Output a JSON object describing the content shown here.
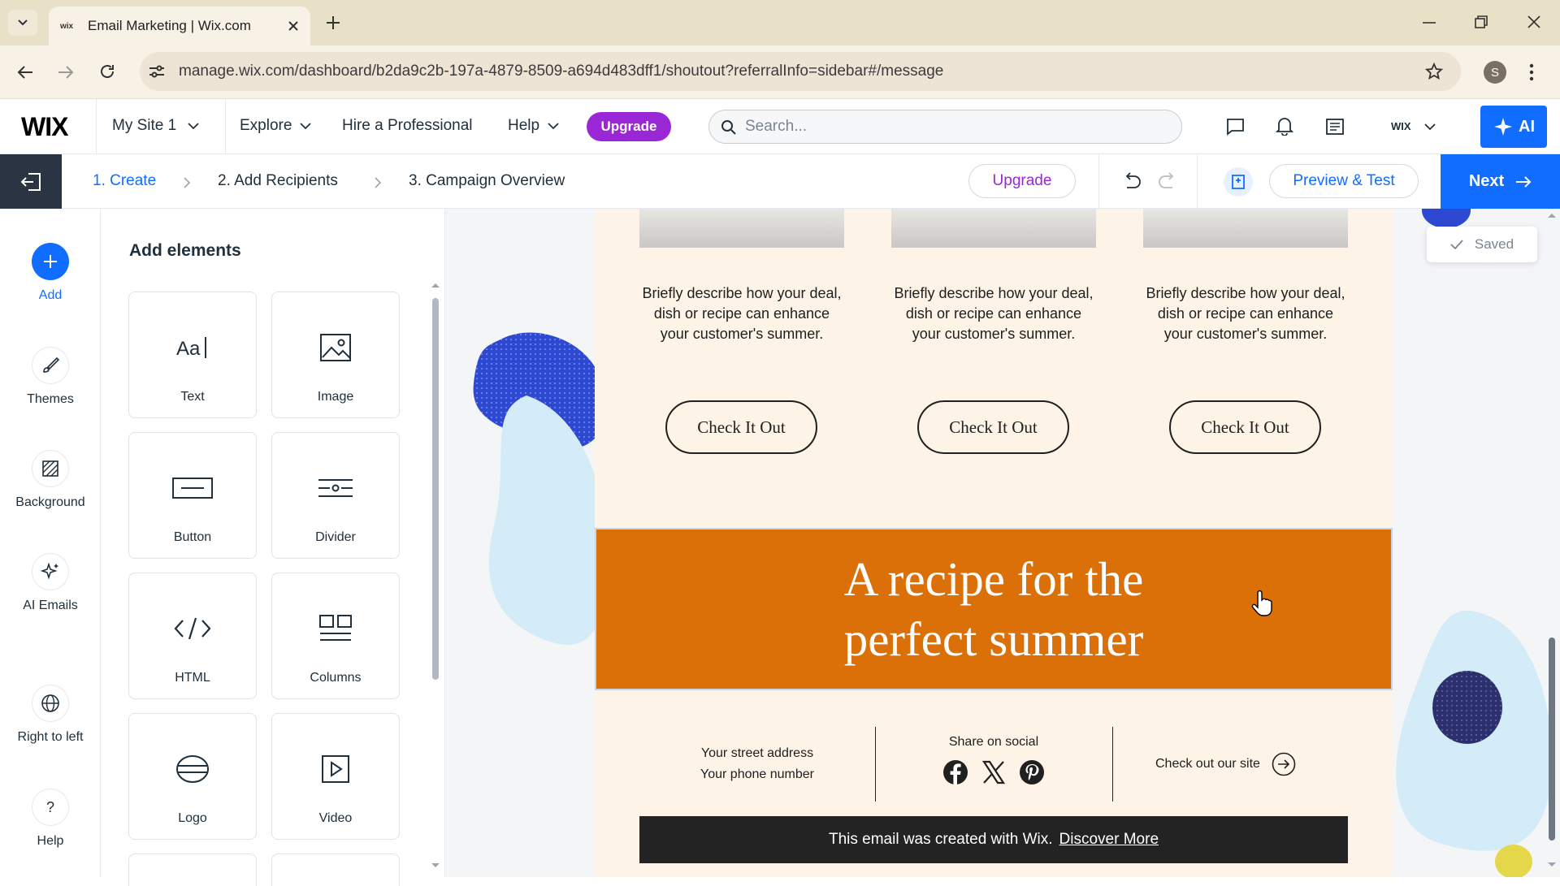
{
  "browser": {
    "tab_title": "Email Marketing | Wix.com",
    "url": "manage.wix.com/dashboard/b2da9c2b-197a-4879-8509-a694d483dff1/shoutout?referralInfo=sidebar#/message",
    "profile_initial": "S"
  },
  "topnav": {
    "logo": "WIX",
    "site_name": "My Site 1",
    "explore": "Explore",
    "hire": "Hire a Professional",
    "help": "Help",
    "upgrade": "Upgrade",
    "search_placeholder": "Search...",
    "account_label": "WIX",
    "ai_label": "AI"
  },
  "steps": {
    "items": [
      "1. Create",
      "2. Add Recipients",
      "3. Campaign Overview"
    ],
    "upgrade": "Upgrade",
    "preview": "Preview & Test",
    "next": "Next",
    "saved": "Saved"
  },
  "rail": {
    "add": "Add",
    "themes": "Themes",
    "background": "Background",
    "ai_emails": "AI Emails",
    "rtl": "Right to left",
    "help": "Help"
  },
  "panel": {
    "title": "Add elements",
    "elements": [
      "Text",
      "Image",
      "Button",
      "Divider",
      "HTML",
      "Columns",
      "Logo",
      "Video"
    ]
  },
  "email": {
    "cards": [
      {
        "description": "Briefly describe how your deal, dish or recipe can enhance your customer's summer.",
        "button": "Check It Out"
      },
      {
        "description": "Briefly describe how your deal, dish or recipe can enhance your customer's summer.",
        "button": "Check It Out"
      },
      {
        "description": "Briefly describe how your deal, dish or recipe can enhance your customer's summer.",
        "button": "Check It Out"
      }
    ],
    "banner_line1": "A recipe for the",
    "banner_line2": "perfect summer",
    "footer": {
      "address": "Your street address",
      "phone": "Your phone number",
      "share_label": "Share on social",
      "site_link": "Check out our site"
    },
    "wix_note": "This email was created with Wix.",
    "wix_link": "Discover More"
  },
  "colors": {
    "accent_blue": "#116dff",
    "upgrade_purple": "#9a27d5",
    "banner_orange": "#dc7008",
    "email_bg": "#fdf3e7"
  }
}
